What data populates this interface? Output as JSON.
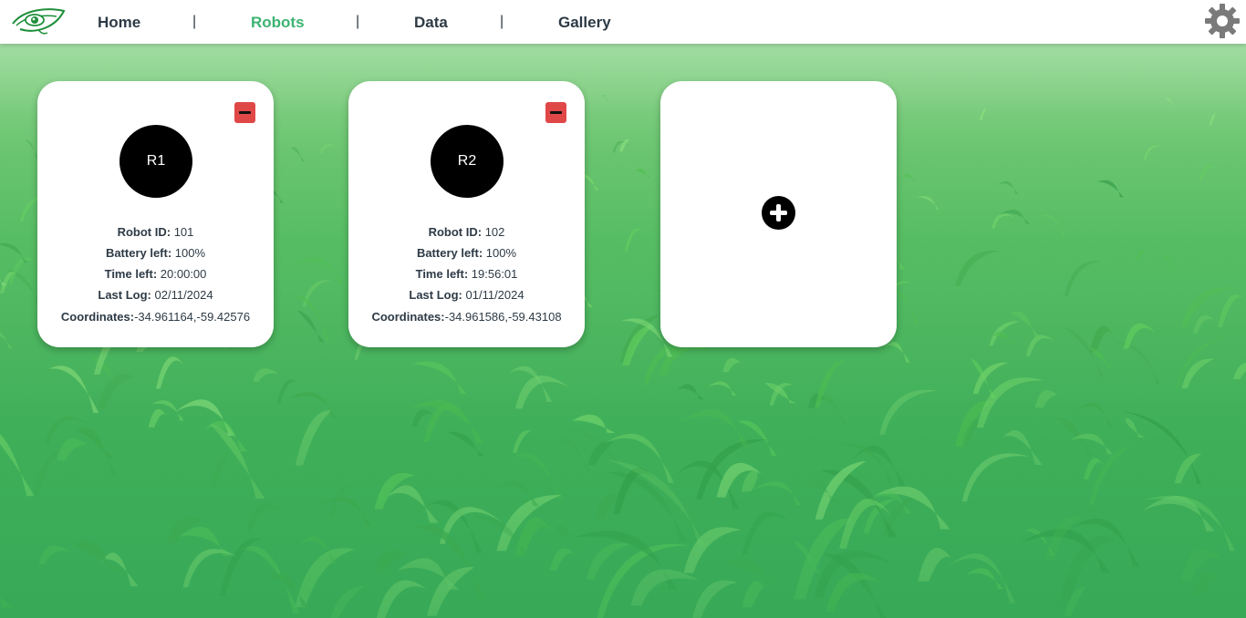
{
  "nav": {
    "logo_icon": "eye-leaf-logo-icon",
    "items": [
      {
        "label": "Home",
        "active": false
      },
      {
        "label": "Robots",
        "active": true
      },
      {
        "label": "Data",
        "active": false
      },
      {
        "label": "Gallery",
        "active": false
      }
    ],
    "separator": "|",
    "settings_icon": "gear-icon"
  },
  "colors": {
    "accent": "#3cb371",
    "remove": "#e04848",
    "text": "#2d3a45"
  },
  "robots": [
    {
      "avatar": "R1",
      "robot_id_label": "Robot ID:",
      "robot_id": " 101",
      "battery_label": "Battery left:",
      "battery": " 100%",
      "time_label": "Time left:",
      "time": " 20:00:00",
      "log_label": "Last Log:",
      "log": " 02/11/2024",
      "coords_label": "Coordinates:",
      "coords": "-34.961164,-59.42576"
    },
    {
      "avatar": "R2",
      "robot_id_label": "Robot ID:",
      "robot_id": " 102",
      "battery_label": "Battery left:",
      "battery": " 100%",
      "time_label": "Time left:",
      "time": " 19:56:01",
      "log_label": "Last Log:",
      "log": " 01/11/2024",
      "coords_label": "Coordinates:",
      "coords": "-34.961586,-59.43108"
    }
  ],
  "add_card": {
    "icon": "plus-circle-icon"
  },
  "remove_icon": "minus-icon",
  "background": "corn-field-image"
}
